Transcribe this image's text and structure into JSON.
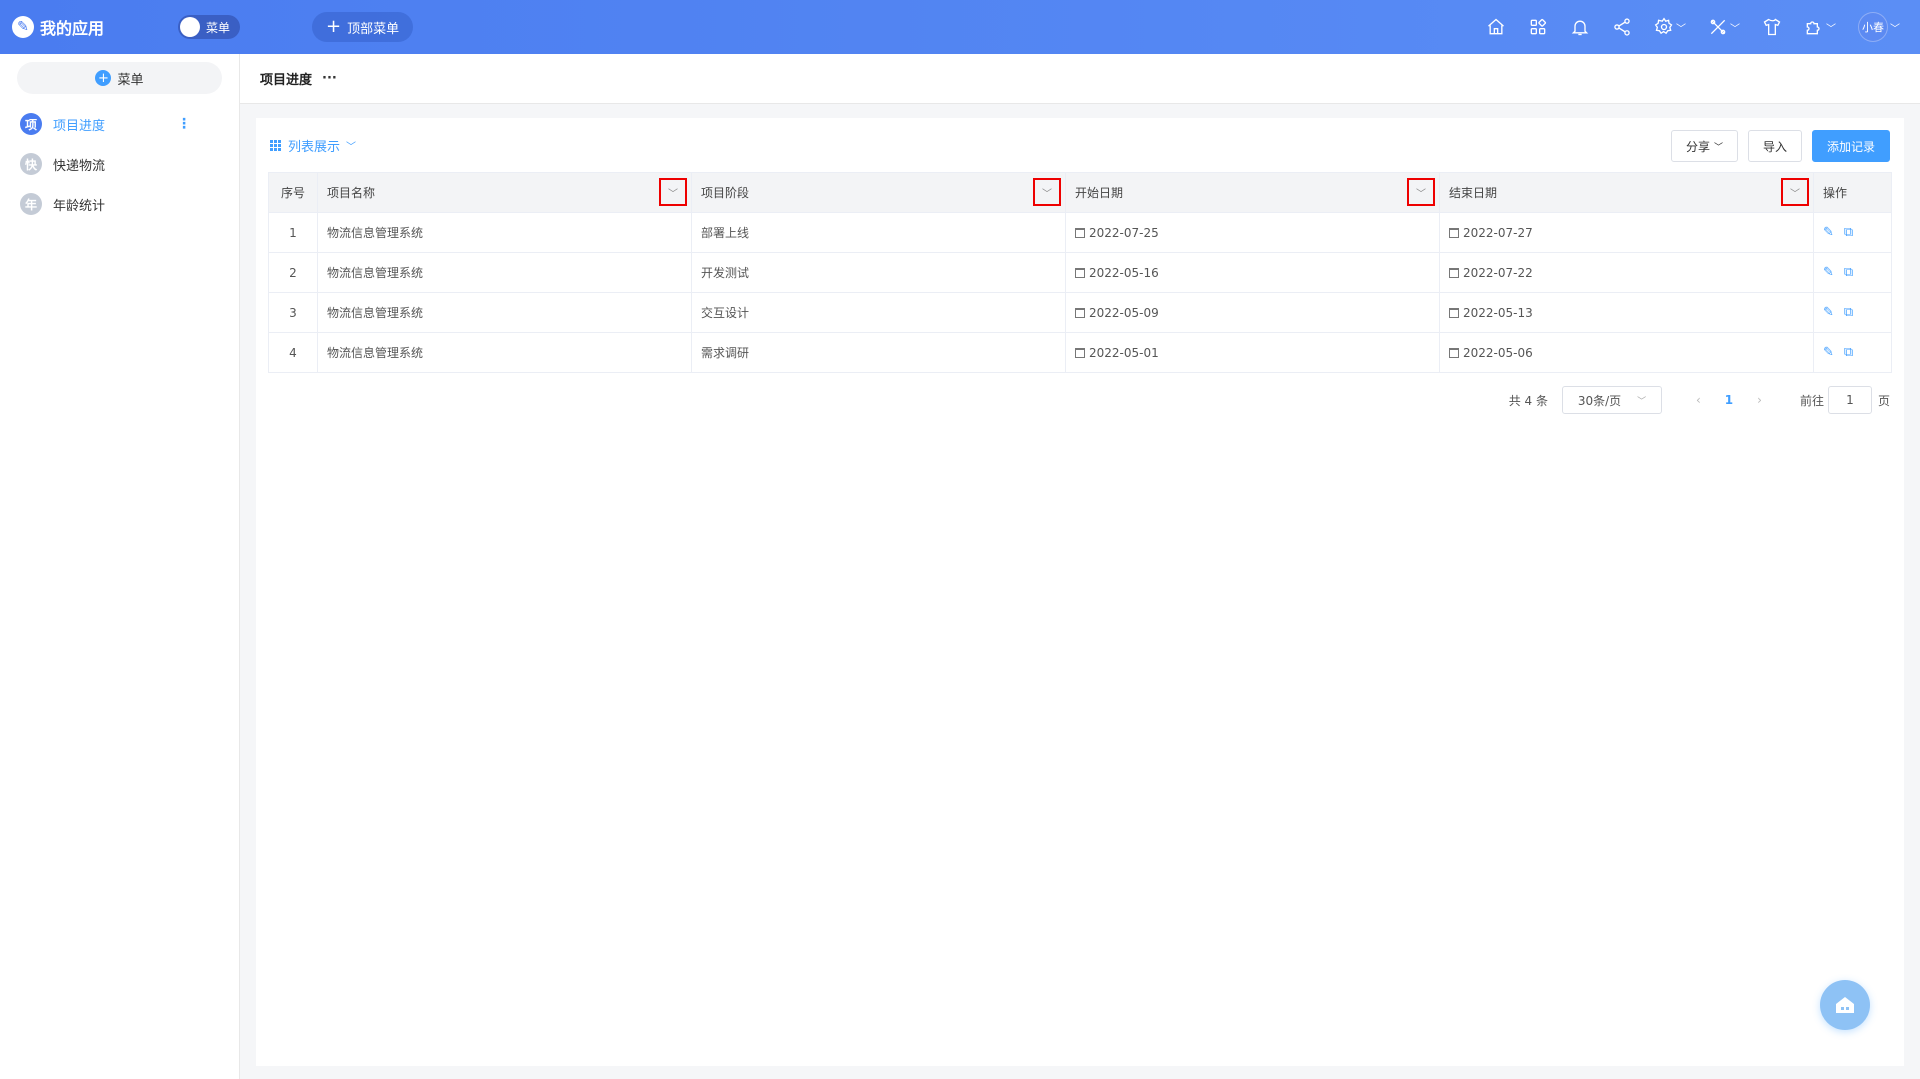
{
  "app": {
    "title": "我的应用",
    "toggle_label": "菜单",
    "top_menu_label": "顶部菜单"
  },
  "topbar": {
    "icons": [
      "home-icon",
      "apps-icon",
      "bell-icon",
      "share-icon",
      "gear-icon",
      "tools-icon",
      "shirt-icon",
      "plugin-icon"
    ],
    "user": "小春"
  },
  "sidebar": {
    "menu_button": "菜单",
    "items": [
      {
        "badge": "项",
        "label": "项目进度",
        "active": true
      },
      {
        "badge": "快",
        "label": "快递物流",
        "active": false
      },
      {
        "badge": "年",
        "label": "年龄统计",
        "active": false
      }
    ]
  },
  "page": {
    "title": "项目进度",
    "more": "···"
  },
  "toolbar": {
    "view_label": "列表展示",
    "share_label": "分享",
    "import_label": "导入",
    "add_label": "添加记录"
  },
  "table": {
    "headers": {
      "num": "序号",
      "name": "项目名称",
      "stage": "项目阶段",
      "start": "开始日期",
      "end": "结束日期",
      "ops": "操作"
    },
    "rows": [
      {
        "num": "1",
        "name": "物流信息管理系统",
        "stage": "部署上线",
        "start": "2022-07-25",
        "end": "2022-07-27"
      },
      {
        "num": "2",
        "name": "物流信息管理系统",
        "stage": "开发测试",
        "start": "2022-05-16",
        "end": "2022-07-22"
      },
      {
        "num": "3",
        "name": "物流信息管理系统",
        "stage": "交互设计",
        "start": "2022-05-09",
        "end": "2022-05-13"
      },
      {
        "num": "4",
        "name": "物流信息管理系统",
        "stage": "需求调研",
        "start": "2022-05-01",
        "end": "2022-05-06"
      }
    ]
  },
  "pager": {
    "total": "共 4 条",
    "page_size": "30条/页",
    "current": "1",
    "goto_label": "前往",
    "goto_value": "1",
    "page_suffix": "页"
  }
}
